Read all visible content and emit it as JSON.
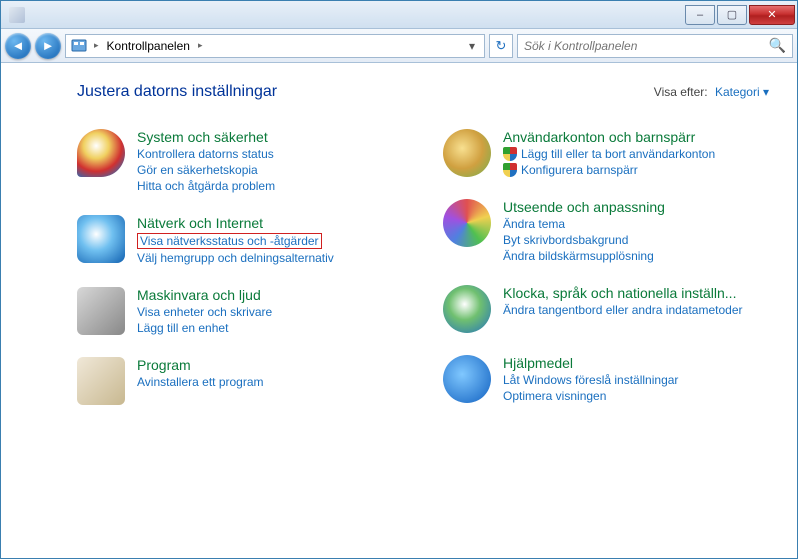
{
  "titlebar": {
    "text": ""
  },
  "window_buttons": {
    "min": "–",
    "max": "▢",
    "close": "✕"
  },
  "nav": {
    "breadcrumb_root": "Kontrollpanelen",
    "search_placeholder": "Sök i Kontrollpanelen"
  },
  "header": {
    "title": "Justera datorns inställningar",
    "view_label": "Visa efter:",
    "view_value": "Kategori ▾"
  },
  "categories": {
    "left": [
      {
        "icon": "shield-icon",
        "title": "System och säkerhet",
        "links": [
          {
            "text": "Kontrollera datorns status"
          },
          {
            "text": "Gör en säkerhetskopia"
          },
          {
            "text": "Hitta och åtgärda problem"
          }
        ]
      },
      {
        "icon": "network-icon",
        "title": "Nätverk och Internet",
        "links": [
          {
            "text": "Visa nätverksstatus och -åtgärder",
            "highlighted": true
          },
          {
            "text": "Välj hemgrupp och delningsalternativ"
          }
        ]
      },
      {
        "icon": "hardware-icon",
        "title": "Maskinvara och ljud",
        "links": [
          {
            "text": "Visa enheter och skrivare"
          },
          {
            "text": "Lägg till en enhet"
          }
        ]
      },
      {
        "icon": "programs-icon",
        "title": "Program",
        "links": [
          {
            "text": "Avinstallera ett program"
          }
        ]
      }
    ],
    "right": [
      {
        "icon": "users-icon",
        "title": "Användarkonton och barnspärr",
        "links": [
          {
            "text": "Lägg till eller ta bort användarkonton",
            "shield": true
          },
          {
            "text": "Konfigurera barnspärr",
            "shield": true
          }
        ]
      },
      {
        "icon": "appearance-icon",
        "title": "Utseende och anpassning",
        "links": [
          {
            "text": "Ändra tema"
          },
          {
            "text": "Byt skrivbordsbakgrund"
          },
          {
            "text": "Ändra bildskärmsupplösning"
          }
        ]
      },
      {
        "icon": "clock-icon",
        "title": "Klocka, språk och nationella inställn...",
        "links": [
          {
            "text": "Ändra tangentbord eller andra indatametoder"
          }
        ]
      },
      {
        "icon": "ease-icon",
        "title": "Hjälpmedel",
        "links": [
          {
            "text": "Låt Windows föreslå inställningar"
          },
          {
            "text": "Optimera visningen"
          }
        ]
      }
    ]
  }
}
